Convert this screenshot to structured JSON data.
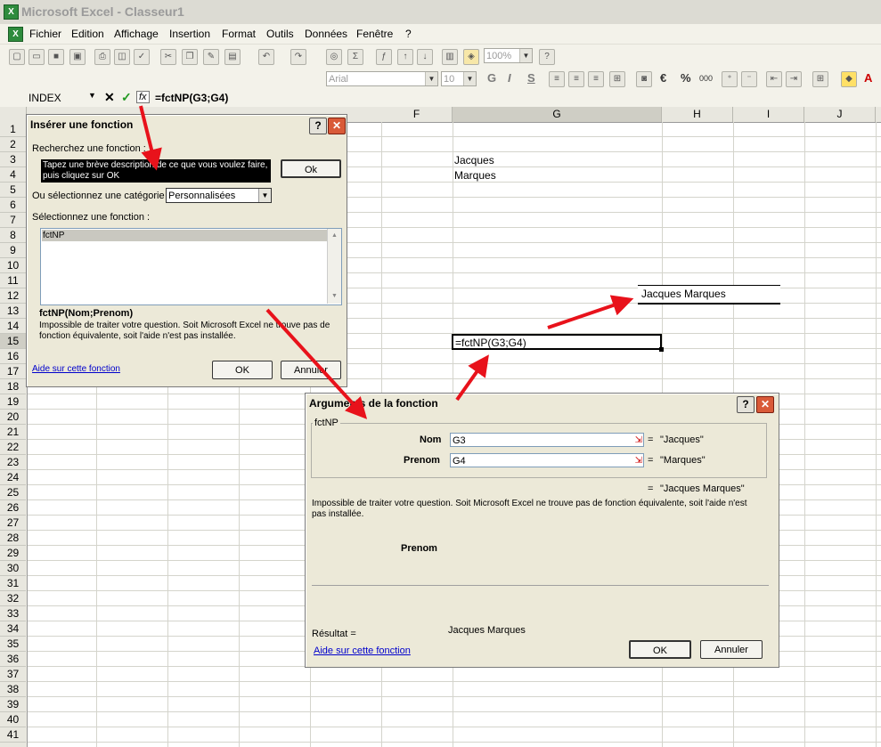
{
  "window": {
    "title": "Microsoft Excel - Classeur1"
  },
  "menubar": {
    "items": [
      "Fichier",
      "Edition",
      "Affichage",
      "Insertion",
      "Format",
      "Outils",
      "Données",
      "Fenêtre",
      "?"
    ]
  },
  "toolbar": {
    "zoom": "100%"
  },
  "format_toolbar": {
    "font": "Arial",
    "size": "10",
    "bold": "G",
    "italic": "I",
    "underline": "S",
    "euro": "€",
    "percent": "%",
    "thousands": "000"
  },
  "formula_bar": {
    "name_box": "INDEX",
    "cancel": "✕",
    "enter": "✓",
    "fx": "fx",
    "formula": "=fctNP(G3;G4)"
  },
  "grid": {
    "columns": [
      "F",
      "G",
      "H",
      "I",
      "J"
    ],
    "rows": [
      "1",
      "2",
      "3",
      "4",
      "5",
      "6",
      "7",
      "8",
      "9",
      "10",
      "11",
      "12",
      "13",
      "14",
      "15",
      "16",
      "17",
      "18",
      "19",
      "20",
      "21",
      "22",
      "23",
      "24",
      "25",
      "26",
      "27",
      "28",
      "29",
      "30",
      "31",
      "32",
      "33",
      "34",
      "35",
      "36",
      "37",
      "38",
      "39",
      "40",
      "41"
    ],
    "cells": {
      "G3": "Jacques",
      "G4": "Marques",
      "G12": "Jacques Marques",
      "G15": "=fctNP(G3;G4)"
    }
  },
  "insert_dialog": {
    "title": "Insérer une fonction",
    "help": "?",
    "close": "✕",
    "search_label": "Recherchez une fonction :",
    "search_value": "Tapez une brève description de ce que vous voulez faire, puis cliquez sur OK",
    "ok_search": "Ok",
    "category_label": "Ou sélectionnez une catégorie :",
    "category_value": "Personnalisées",
    "select_label": "Sélectionnez une fonction :",
    "functions": [
      "fctNP"
    ],
    "signature": "fctNP(Nom;Prenom)",
    "description": "Impossible de traiter votre question. Soit Microsoft Excel ne trouve pas de fonction équivalente, soit l'aide n'est pas installée.",
    "help_link": "Aide sur cette fonction",
    "ok": "OK",
    "cancel": "Annuler"
  },
  "args_dialog": {
    "title": "Arguments de la fonction",
    "help": "?",
    "close": "✕",
    "group": "fctNP",
    "args": [
      {
        "label": "Nom",
        "value": "G3",
        "result": "\"Jacques\""
      },
      {
        "label": "Prenom",
        "value": "G4",
        "result": "\"Marques\""
      }
    ],
    "eq": "=",
    "overall_result": "\"Jacques Marques\"",
    "description": "Impossible de traiter votre question. Soit Microsoft Excel ne trouve pas de fonction équivalente, soit l'aide n'est pas installée.",
    "arg_help": "Prenom",
    "result_label": "Résultat =",
    "result_value": "Jacques Marques",
    "help_link": "Aide sur cette fonction",
    "ok": "OK",
    "cancel": "Annuler"
  },
  "colors": {
    "arrow": "#e8121b",
    "dialog_bg": "#ece9d8",
    "title_red": "#d95a38"
  }
}
